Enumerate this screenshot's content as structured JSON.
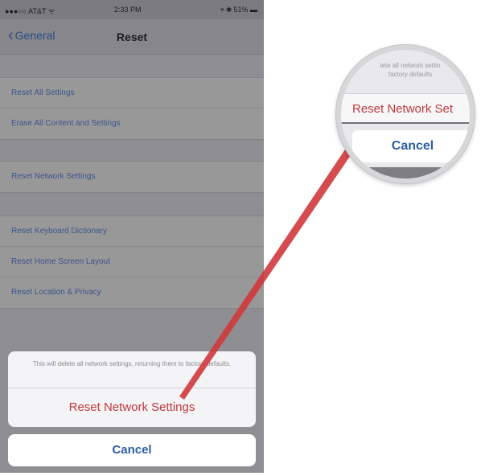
{
  "status_bar": {
    "carrier": "●●●○○ AT&T ᯤ",
    "time": "2:33 PM",
    "battery": "⌖ ✱ 51% ▬"
  },
  "nav": {
    "back_label": "General",
    "title": "Reset"
  },
  "groups": [
    [
      "Reset All Settings",
      "Erase All Content and Settings"
    ],
    [
      "Reset Network Settings"
    ],
    [
      "Reset Keyboard Dictionary",
      "Reset Home Screen Layout",
      "Reset Location & Privacy"
    ]
  ],
  "action_sheet": {
    "message": "This will delete all network settings, returning them to factory defaults.",
    "confirm_label": "Reset Network Settings",
    "cancel_label": "Cancel"
  },
  "magnifier": {
    "message_line1": "lete all network settin",
    "message_line2": "factory defaults",
    "reset_label": "Reset Network Set",
    "cancel_label": "Cancel"
  },
  "icons": {
    "back": "chevron-left-icon",
    "arrow": "red-pointer-arrow"
  },
  "colors": {
    "destructive": "#c1383c",
    "link": "#2a5fa8",
    "arrow": "#d0393c"
  }
}
